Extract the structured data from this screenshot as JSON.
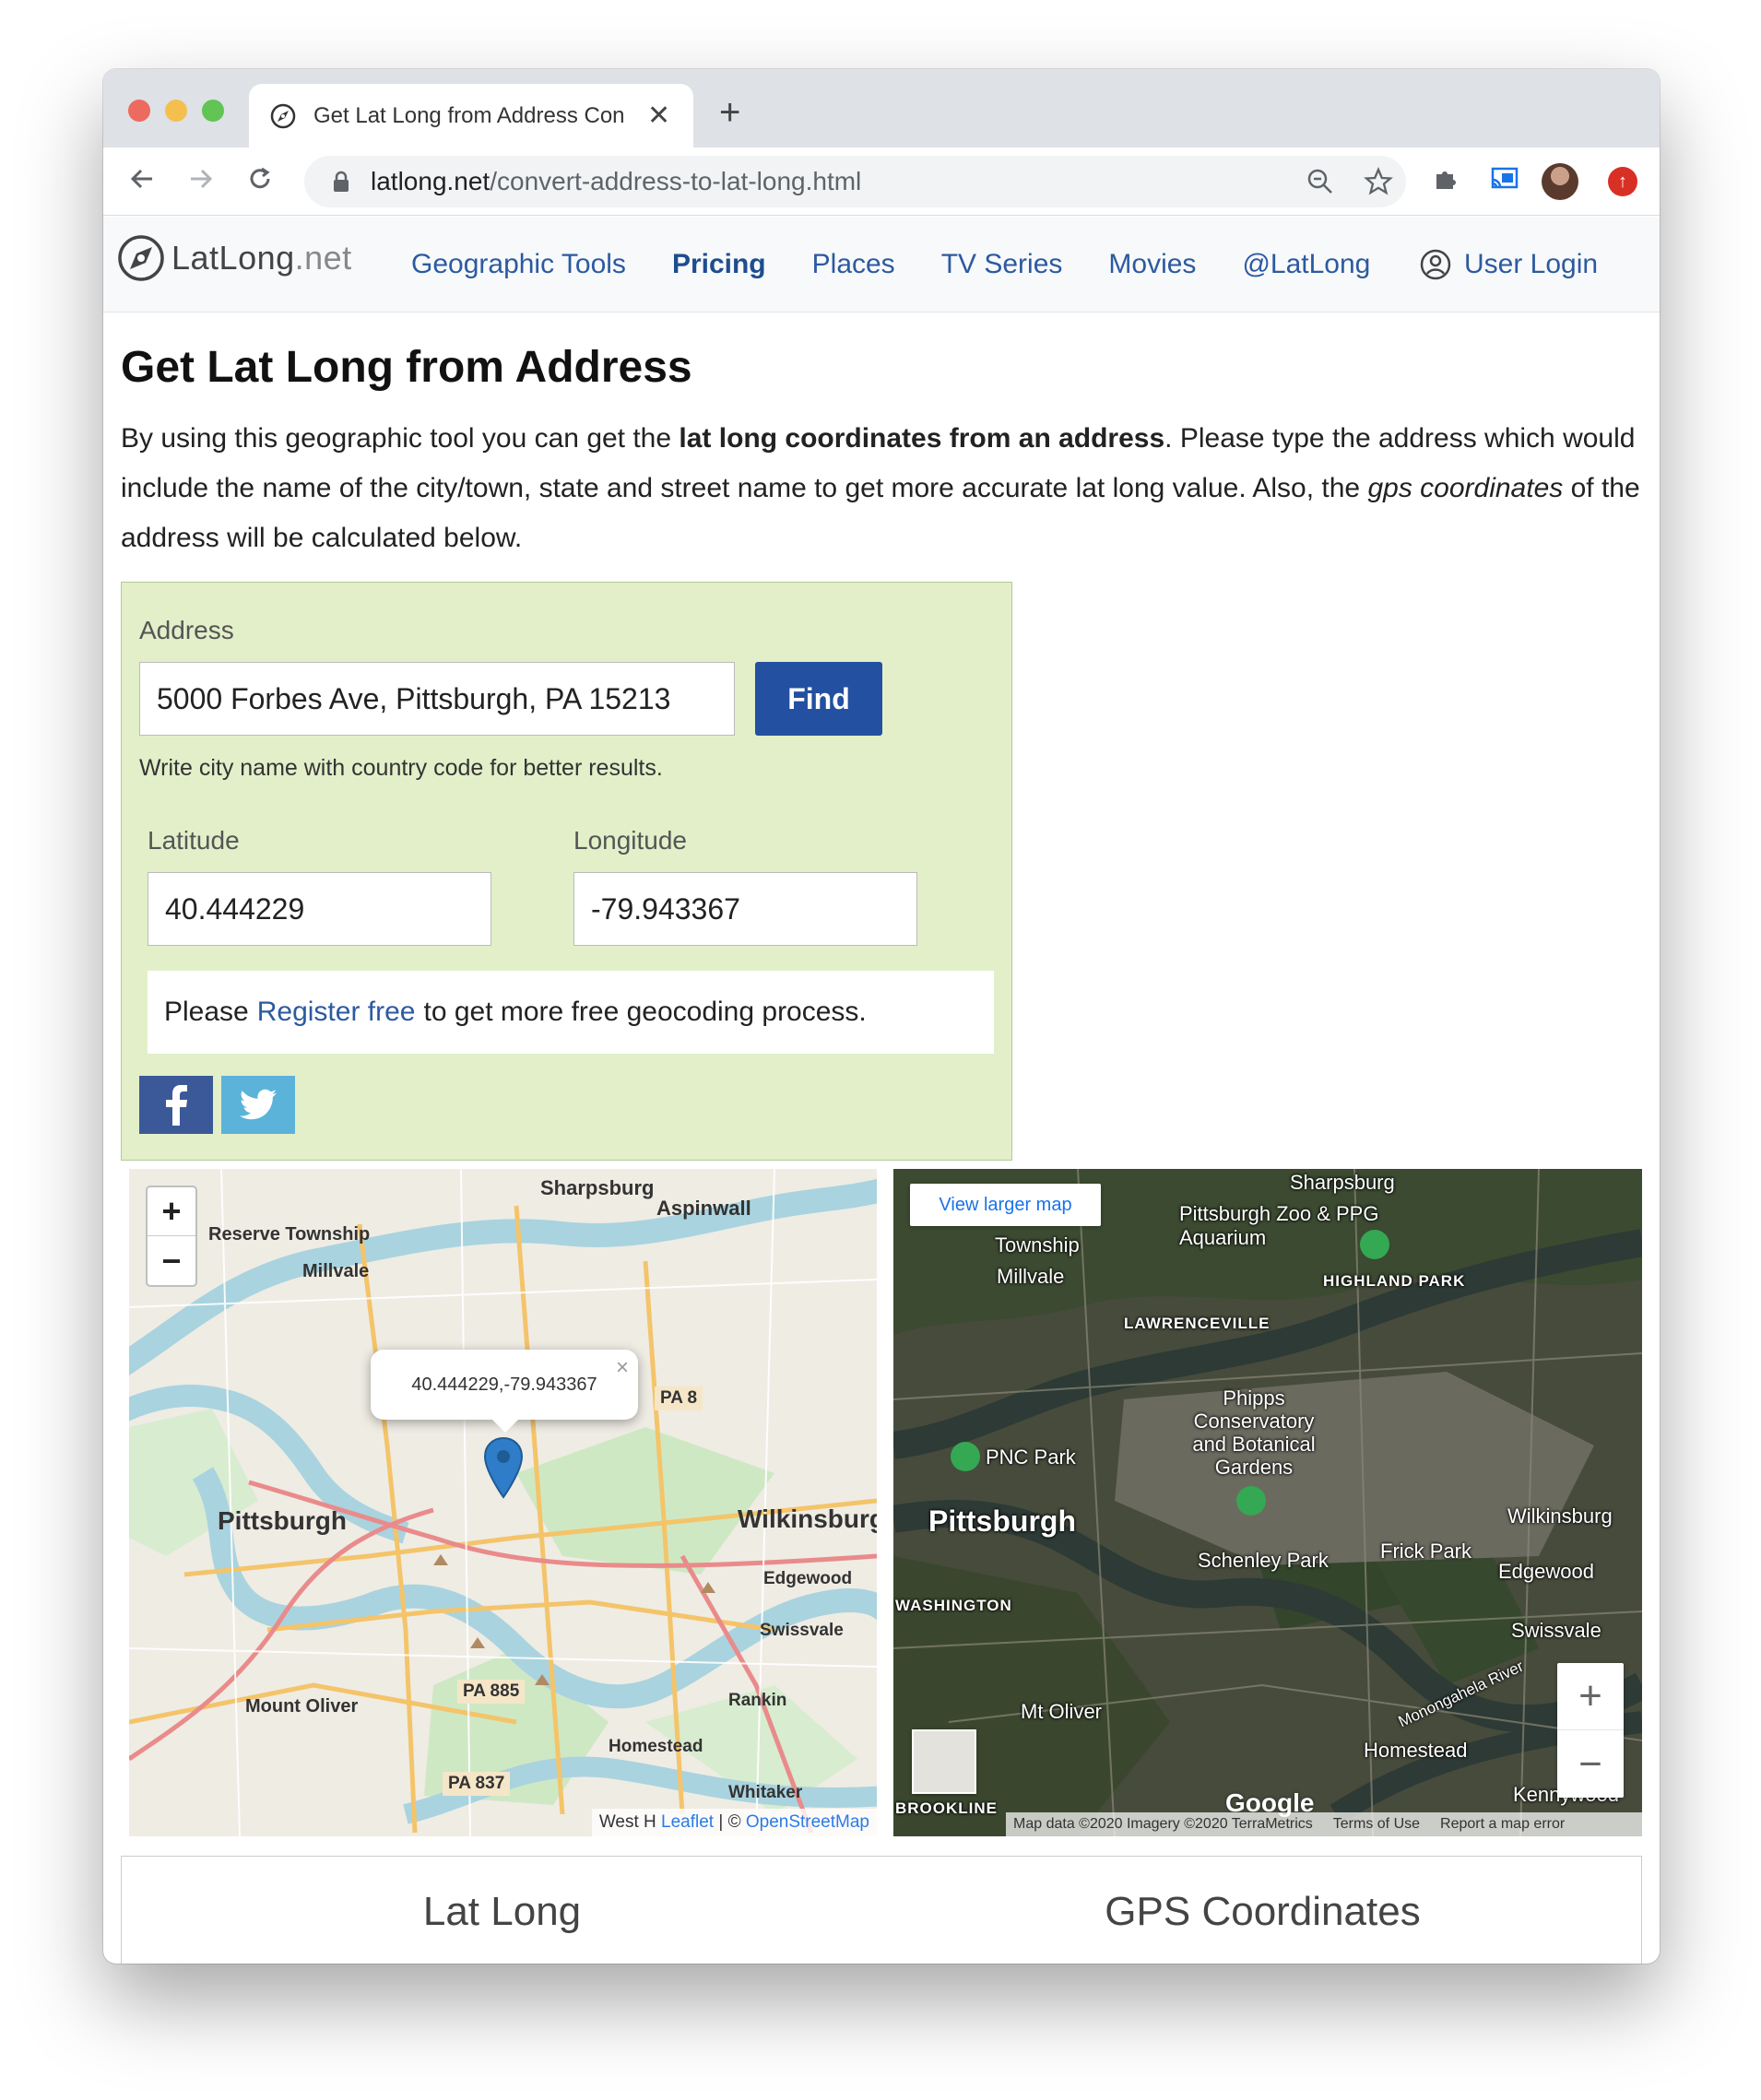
{
  "browser": {
    "tab_title": "Get Lat Long from Address Con",
    "tab_close": "✕",
    "new_tab": "+",
    "url_host": "latlong.net",
    "url_path": "/convert-address-to-lat-long.html"
  },
  "site": {
    "logo_main": "LatLong",
    "logo_tld": ".net",
    "nav": [
      {
        "label": "Geographic Tools"
      },
      {
        "label": "Pricing"
      },
      {
        "label": "Places"
      },
      {
        "label": "TV Series"
      },
      {
        "label": "Movies"
      },
      {
        "label": "@LatLong"
      }
    ],
    "login_label": "User Login"
  },
  "page": {
    "title": "Get Lat Long from Address",
    "intro_1": "By using this geographic tool you can get the ",
    "intro_bold": "lat long coordinates from an address",
    "intro_2": ". Please type the address which would include the name of the city/town, state and street name to get more accurate lat long value. Also, the ",
    "intro_italic": "gps coordinates",
    "intro_3": " of the address will be calculated below."
  },
  "tool": {
    "address_label": "Address",
    "address_value": "5000 Forbes Ave, Pittsburgh, PA 15213",
    "find_label": "Find",
    "hint": "Write city name with country code for better results.",
    "latitude_label": "Latitude",
    "latitude_value": "40.444229",
    "longitude_label": "Longitude",
    "longitude_value": "-79.943367",
    "register_pre": "Please",
    "register_link": "Register free",
    "register_post": "to get more free geocoding process."
  },
  "street_map": {
    "zoom_in": "+",
    "zoom_out": "−",
    "popup_text": "40.444229,-79.943367",
    "popup_close": "×",
    "attrib_prefix": "West H",
    "attrib_leaflet": "Leaflet",
    "attrib_sep": " | © ",
    "attrib_osm": "OpenStreetMap",
    "labels": {
      "pittsburgh": "Pittsburgh",
      "wilkinsburg": "Wilkinsburg",
      "sharpsburg": "Sharpsburg",
      "aspinwall": "Aspinwall",
      "reserve": "Reserve Township",
      "millvale": "Millvale",
      "edgewood": "Edgewood",
      "swissvale": "Swissvale",
      "mount_oliver": "Mount Oliver",
      "homestead": "Homestead",
      "whitaker": "Whitaker",
      "rankin": "Rankin",
      "pa8": "PA 8",
      "pa885": "PA 885",
      "pa837": "PA 837"
    }
  },
  "sat_map": {
    "view_larger": "View larger map",
    "zoom_in": "+",
    "zoom_out": "−",
    "footer_data": "Map data ©2020 Imagery ©2020 TerraMetrics",
    "footer_terms": "Terms of Use",
    "footer_report": "Report a map error",
    "google": "Google",
    "labels": {
      "pittsburgh": "Pittsburgh",
      "sharpsburg": "Sharpsburg",
      "zoo": "Pittsburgh Zoo & PPG Aquarium",
      "highland": "HIGHLAND PARK",
      "lawrenceville": "LAWRENCEVILLE",
      "millvale": "Millvale",
      "township": "Township",
      "phipps": "Phipps Conservatory and Botanical Gardens",
      "pnc": "PNC Park",
      "schenley": "Schenley Park",
      "frick": "Frick Park",
      "wilkinsburg": "Wilkinsburg",
      "edgewood": "Edgewood",
      "swissvale": "Swissvale",
      "washington": "WASHINGTON",
      "mt_oliver": "Mt Oliver",
      "homestead": "Homestead",
      "kennywood": "Kennywood",
      "brookline": "BROOKLINE",
      "monongahela": "Monongahela River"
    }
  },
  "results": {
    "lat_long": "Lat Long",
    "gps": "GPS Coordinates"
  }
}
